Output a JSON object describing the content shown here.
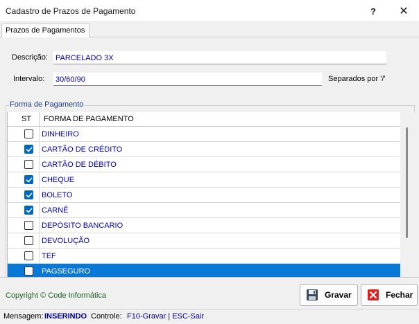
{
  "window": {
    "title": "Cadastro de Prazos de Pagamento",
    "help_glyph": "?",
    "close_glyph": "✕"
  },
  "tab": {
    "label": "Prazos de Pagamentos"
  },
  "form": {
    "descricao_label": "Descrição:",
    "descricao_value": "PARCELADO 3X",
    "intervalo_label": "Intervalo:",
    "intervalo_value": "30/60/90",
    "intervalo_hint": "Separados por '/'"
  },
  "group": {
    "title": "Forma de Pagamento"
  },
  "grid": {
    "columns": [
      "ST",
      "FORMA DE PAGAMENTO"
    ],
    "rows": [
      {
        "name": "DINHEIRO",
        "checked": false
      },
      {
        "name": "CARTÃO DE CRÉDITO",
        "checked": true
      },
      {
        "name": "CARTÃO DE DÉBITO",
        "checked": false
      },
      {
        "name": "CHEQUE",
        "checked": true
      },
      {
        "name": "BOLETO",
        "checked": true
      },
      {
        "name": "CARNÊ",
        "checked": true
      },
      {
        "name": "DEPÓSITO BANCARIO",
        "checked": false
      },
      {
        "name": "DEVOLUÇÃO",
        "checked": false
      },
      {
        "name": "TEF",
        "checked": false
      },
      {
        "name": "PAGSEGURO",
        "checked": false,
        "selected": true
      }
    ]
  },
  "footer": {
    "copyright": "Copyright © Code Informática",
    "gravar_label": "Gravar",
    "fechar_label": "Fechar"
  },
  "status": {
    "mensagem_label": "Mensagem:",
    "mensagem_value": "INSERINDO",
    "controle_label": "Controle:",
    "controle_value": "F10-Gravar | ESC-Sair"
  },
  "colors": {
    "value_text": "#0000b3",
    "selection": "#0a78d7",
    "checkbox_on": "#0067c0",
    "copyright": "#1d5b1d"
  }
}
